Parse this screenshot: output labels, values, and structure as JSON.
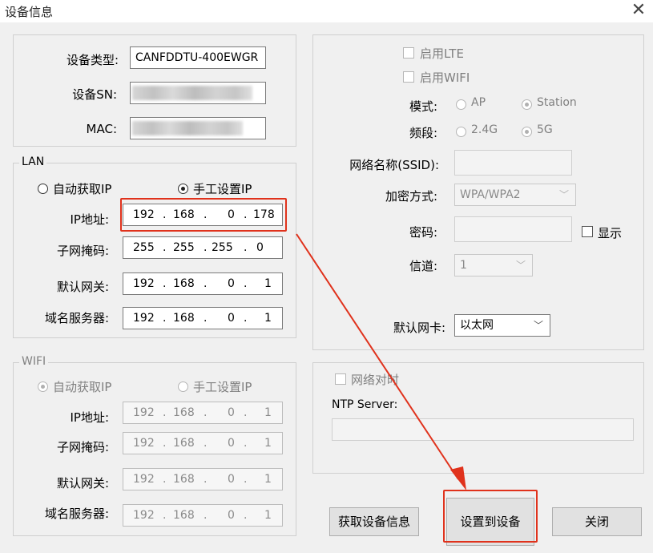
{
  "window": {
    "title": "设备信息"
  },
  "device": {
    "type_label": "设备类型:",
    "type_value": "CANFDDTU-400EWGR",
    "sn_label": "设备SN:",
    "mac_label": "MAC:"
  },
  "lan": {
    "legend": "LAN",
    "radio_auto": "自动获取IP",
    "radio_manual": "手工设置IP",
    "ip_label": "IP地址:",
    "ip": [
      "192",
      "168",
      "0",
      "178"
    ],
    "mask_label": "子网掩码:",
    "mask": [
      "255",
      "255",
      "255",
      "0"
    ],
    "gateway_label": "默认网关:",
    "gateway": [
      "192",
      "168",
      "0",
      "1"
    ],
    "dns_label": "域名服务器:",
    "dns": [
      "192",
      "168",
      "0",
      "1"
    ]
  },
  "wifi": {
    "legend": "WIFI",
    "radio_auto": "自动获取IP",
    "radio_manual": "手工设置IP",
    "ip_label": "IP地址:",
    "ip": [
      "192",
      "168",
      "0",
      "1"
    ],
    "mask_label": "子网掩码:",
    "mask": [
      "192",
      "168",
      "0",
      "1"
    ],
    "gateway_label": "默认网关:",
    "gateway": [
      "192",
      "168",
      "0",
      "1"
    ],
    "dns_label": "域名服务器:",
    "dns": [
      "192",
      "168",
      "0",
      "1"
    ]
  },
  "wireless": {
    "enable_lte": "启用LTE",
    "enable_wifi": "启用WIFI",
    "mode_label": "模式:",
    "mode_ap": "AP",
    "mode_station": "Station",
    "band_label": "频段:",
    "band_24": "2.4G",
    "band_5": "5G",
    "ssid_label": "网络名称(SSID):",
    "encrypt_label": "加密方式:",
    "encrypt_value": "WPA/WPA2",
    "password_label": "密码:",
    "show_label": "显示",
    "channel_label": "信道:",
    "channel_value": "1",
    "default_nic_label": "默认网卡:",
    "default_nic_value": "以太网"
  },
  "ntp": {
    "sync_label": "网络对时",
    "server_label": "NTP Server:"
  },
  "buttons": {
    "get_info": "获取设备信息",
    "set_device": "设置到设备",
    "close": "关闭"
  },
  "colors": {
    "highlight": "#e0321c"
  }
}
